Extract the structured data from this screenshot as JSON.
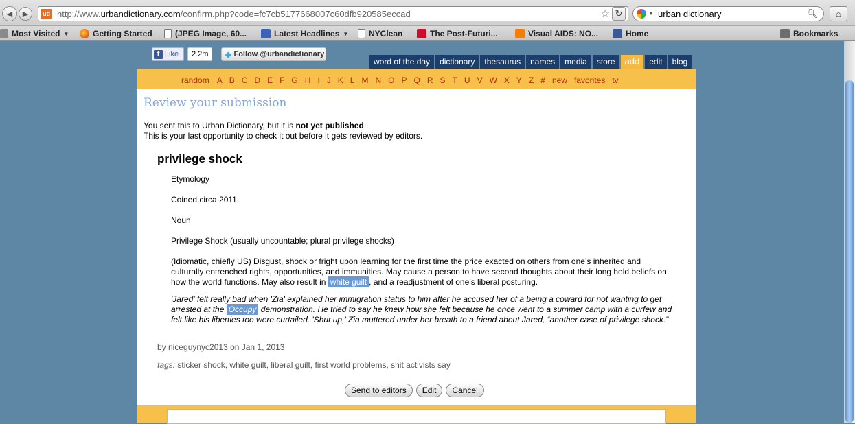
{
  "browser": {
    "url_prefix": "http://www.",
    "url_domain": "urbandictionary.com",
    "url_path": "/confirm.php?code=fc7cb5177668007c60dfb920585eccad",
    "favicon_text": "ud",
    "search_query": "urban dictionary",
    "bookmarks": [
      {
        "label": "Most Visited",
        "icon": "star-folder-icon"
      },
      {
        "label": "Getting Started",
        "icon": "firefox-icon"
      },
      {
        "label": "(JPEG Image, 60...",
        "icon": "page-icon"
      },
      {
        "label": "Latest Headlines",
        "icon": "rss-icon"
      },
      {
        "label": "NYClean",
        "icon": "page-icon"
      },
      {
        "label": "The Post-Futuri...",
        "icon": "red-page-icon"
      },
      {
        "label": "Visual AIDS: NO...",
        "icon": "blogger-icon"
      },
      {
        "label": "Home",
        "icon": "facebook-icon"
      },
      {
        "label": "Bookmarks",
        "icon": "bookmarks-icon"
      }
    ]
  },
  "social": {
    "fb_like": "Like",
    "fb_count": "2.2m",
    "twitter_follow": "Follow @urbandictionary"
  },
  "nav": {
    "tabs": [
      "word of the day",
      "dictionary",
      "thesaurus",
      "names",
      "media",
      "store",
      "add",
      "edit",
      "blog"
    ],
    "active_tab": "add",
    "letters": [
      "random",
      "A",
      "B",
      "C",
      "D",
      "E",
      "F",
      "G",
      "H",
      "I",
      "J",
      "K",
      "L",
      "M",
      "N",
      "O",
      "P",
      "Q",
      "R",
      "S",
      "T",
      "U",
      "V",
      "W",
      "X",
      "Y",
      "Z",
      "#",
      "new",
      "favorites",
      "tv"
    ]
  },
  "review": {
    "title": "Review your submission",
    "line1_pre": "You sent this to Urban Dictionary, but it is ",
    "line1_bold": "not yet published",
    "line1_post": ".",
    "line2": "This is your last opportunity to check it out before it gets reviewed by editors."
  },
  "entry": {
    "word": "privilege shock",
    "etymology_label": "Etymology",
    "coined": "Coined circa 2011.",
    "pos": "Noun",
    "plural": "Privilege Shock (usually uncountable; plural privilege shocks)",
    "def_pre": "(Idiomatic, chiefly US) Disgust, shock or fright upon learning for the first time the price exacted on others from one’s inherited and culturally entrenched rights, opportunities, and immunities. May cause a person to have second thoughts about their long held beliefs on how the world functions. May also result in ",
    "def_link": "white guilt",
    "def_post": ", and a readjustment of one’s liberal posturing.",
    "example_pre": "'Jared' felt really bad when 'Zia' explained her immigration status to him after he accused her of a being a coward for not wanting to get arrested at the ",
    "example_link": "Occupy",
    "example_post": " demonstration. He tried to say he knew how she felt because he once went to a summer camp with a curfew and felt like his liberties too were curtailed. 'Shut up,' Zia muttered under her breath to a friend about Jared, “another case of privilege shock.”",
    "byline": "by niceguynyc2013 on Jan 1, 2013",
    "tags_label": "tags:",
    "tags": "sticker shock, white guilt, liberal guilt, first world problems, shit activists say"
  },
  "actions": {
    "send": "Send to editors",
    "edit": "Edit",
    "cancel": "Cancel"
  },
  "colors": {
    "brand_orange": "#f7c04a",
    "nav_blue": "#1b3e6d",
    "letter_red": "#b22a0a",
    "highlight": "#6a9ad6",
    "page_bg": "#5e87a6"
  }
}
